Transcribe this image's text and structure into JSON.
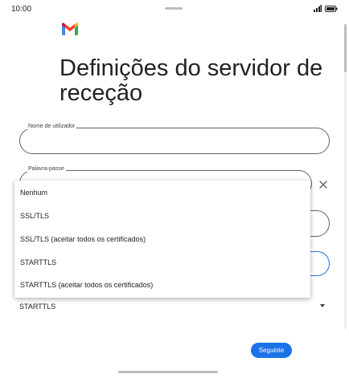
{
  "status_bar": {
    "time": "10:00",
    "signal_icon": "signal-icon",
    "battery_icon": "battery-icon"
  },
  "app": {
    "logo_icon": "gmail-logo-icon",
    "colors": {
      "gmail_red": "#ea4335",
      "gmail_blue": "#4285f4",
      "gmail_green": "#34a853",
      "gmail_yellow": "#fbbc04",
      "accent": "#1a73e8"
    }
  },
  "page": {
    "title": "Definições do servidor de receção"
  },
  "form": {
    "username_label": "Nome de utilizador",
    "username_value": "",
    "password_label": "Palavra-passe",
    "password_value": ""
  },
  "security_dropdown": {
    "options": [
      "Nenhum",
      "SSL/TLS",
      "SSL/TLS (aceitar todos os certificados)",
      "STARTTLS",
      "STARTTLS (aceitar todos os certificados)"
    ],
    "selected": "STARTTLS"
  },
  "actions": {
    "next_label": "Seguinte"
  }
}
